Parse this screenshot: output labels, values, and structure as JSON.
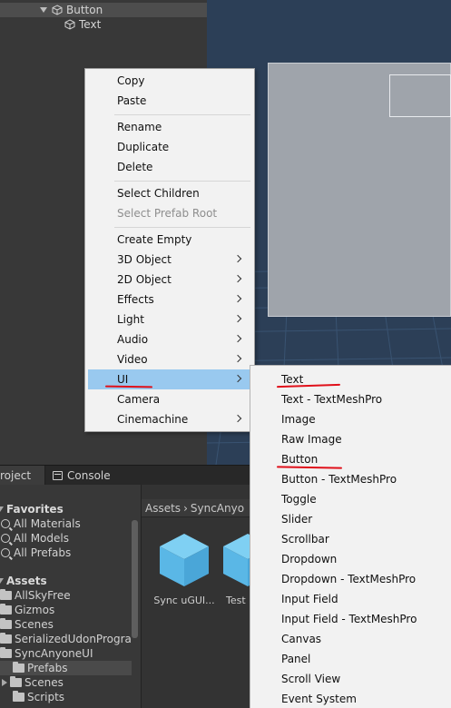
{
  "hierarchy": {
    "items": [
      {
        "label": "Button"
      },
      {
        "label": "Text"
      }
    ]
  },
  "tabs": {
    "project": "roject",
    "console": "Console"
  },
  "project_tree": {
    "favorites_header": "Favorites",
    "favorites": [
      "All Materials",
      "All Models",
      "All Prefabs"
    ],
    "assets_header": "Assets",
    "folders": [
      "AllSkyFree",
      "Gizmos",
      "Scenes",
      "SerializedUdonProgra",
      "SyncAnyoneUI",
      "Prefabs",
      "Scenes",
      "Scripts"
    ]
  },
  "asset_view": {
    "breadcrumb_root": "Assets",
    "breadcrumb_sep": "›",
    "breadcrumb_current": "SyncAnyo",
    "items": [
      "Sync uGUI...",
      "Test"
    ]
  },
  "context_menu": {
    "items": [
      {
        "label": "Copy"
      },
      {
        "label": "Paste"
      },
      {
        "label": "Rename"
      },
      {
        "label": "Duplicate"
      },
      {
        "label": "Delete"
      },
      {
        "label": "Select Children"
      },
      {
        "label": "Select Prefab Root"
      },
      {
        "label": "Create Empty"
      },
      {
        "label": "3D Object"
      },
      {
        "label": "2D Object"
      },
      {
        "label": "Effects"
      },
      {
        "label": "Light"
      },
      {
        "label": "Audio"
      },
      {
        "label": "Video"
      },
      {
        "label": "UI"
      },
      {
        "label": "Camera"
      },
      {
        "label": "Cinemachine"
      }
    ]
  },
  "ui_submenu": {
    "items": [
      {
        "label": "Text"
      },
      {
        "label": "Text - TextMeshPro"
      },
      {
        "label": "Image"
      },
      {
        "label": "Raw Image"
      },
      {
        "label": "Button"
      },
      {
        "label": "Button - TextMeshPro"
      },
      {
        "label": "Toggle"
      },
      {
        "label": "Slider"
      },
      {
        "label": "Scrollbar"
      },
      {
        "label": "Dropdown"
      },
      {
        "label": "Dropdown - TextMeshPro"
      },
      {
        "label": "Input Field"
      },
      {
        "label": "Input Field - TextMeshPro"
      },
      {
        "label": "Canvas"
      },
      {
        "label": "Panel"
      },
      {
        "label": "Scroll View"
      },
      {
        "label": "Event System"
      }
    ]
  },
  "colors": {
    "menu_bg": "#f2f2f2",
    "menu_highlight": "#99c9ef",
    "annotation_red": "#e0101a",
    "scene_bg": "#2c3f57",
    "editor_bg": "#383838"
  }
}
